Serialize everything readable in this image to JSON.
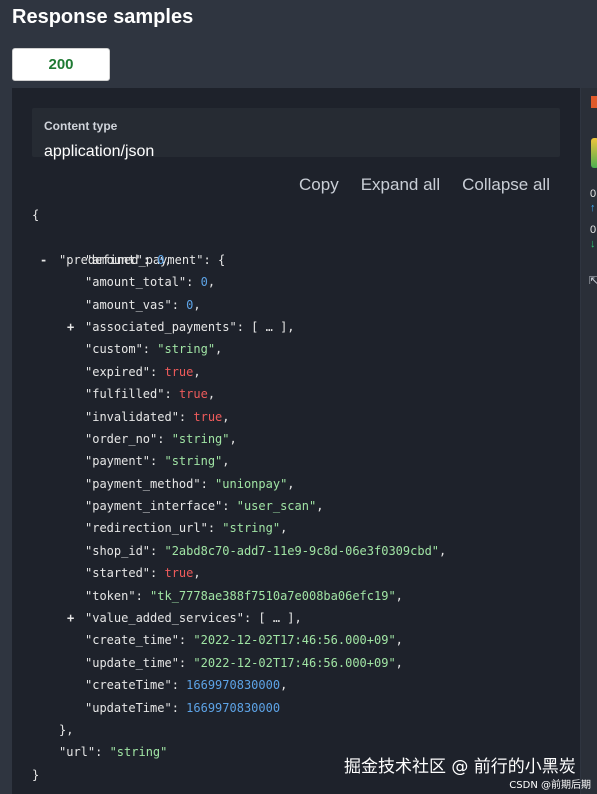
{
  "header": {
    "title": "Response samples"
  },
  "tabs": [
    {
      "label": "200"
    }
  ],
  "content_type": {
    "label": "Content type",
    "value": "application/json"
  },
  "actions": {
    "copy": "Copy",
    "expand_all": "Expand all",
    "collapse_all": "Collapse all"
  },
  "code": {
    "open_brace": "{",
    "close_brace": "}",
    "predefined_key": "\"predefined_payment\"",
    "predefined_open": ": {",
    "predefined_close": "},",
    "collapse_sign": "-",
    "expand_sign": "+",
    "fields": [
      {
        "key": "\"amount\"",
        "value": "0",
        "type": "n",
        "suffix": ","
      },
      {
        "key": "\"amount_total\"",
        "value": "0",
        "type": "n",
        "suffix": ","
      },
      {
        "key": "\"amount_vas\"",
        "value": "0",
        "type": "n",
        "suffix": ","
      },
      {
        "key": "\"associated_payments\"",
        "value": "[ … ]",
        "type": "p",
        "suffix": ",",
        "toggle": "+"
      },
      {
        "key": "\"custom\"",
        "value": "\"string\"",
        "type": "s",
        "suffix": ","
      },
      {
        "key": "\"expired\"",
        "value": "true",
        "type": "b",
        "suffix": ","
      },
      {
        "key": "\"fulfilled\"",
        "value": "true",
        "type": "b",
        "suffix": ","
      },
      {
        "key": "\"invalidated\"",
        "value": "true",
        "type": "b",
        "suffix": ","
      },
      {
        "key": "\"order_no\"",
        "value": "\"string\"",
        "type": "s",
        "suffix": ","
      },
      {
        "key": "\"payment\"",
        "value": "\"string\"",
        "type": "s",
        "suffix": ","
      },
      {
        "key": "\"payment_method\"",
        "value": "\"unionpay\"",
        "type": "s",
        "suffix": ","
      },
      {
        "key": "\"payment_interface\"",
        "value": "\"user_scan\"",
        "type": "s",
        "suffix": ","
      },
      {
        "key": "\"redirection_url\"",
        "value": "\"string\"",
        "type": "s",
        "suffix": ","
      },
      {
        "key": "\"shop_id\"",
        "value": "\"2abd8c70-add7-11e9-9c8d-06e3f0309cbd\"",
        "type": "s",
        "suffix": ","
      },
      {
        "key": "\"started\"",
        "value": "true",
        "type": "b",
        "suffix": ","
      },
      {
        "key": "\"token\"",
        "value": "\"tk_7778ae388f7510a7e008ba06efc19\"",
        "type": "s",
        "suffix": ","
      },
      {
        "key": "\"value_added_services\"",
        "value": "[ … ]",
        "type": "p",
        "suffix": ",",
        "toggle": "+"
      },
      {
        "key": "\"create_time\"",
        "value": "\"2022-12-02T17:46:56.000+09\"",
        "type": "s",
        "suffix": ","
      },
      {
        "key": "\"update_time\"",
        "value": "\"2022-12-02T17:46:56.000+09\"",
        "type": "s",
        "suffix": ","
      },
      {
        "key": "\"createTime\"",
        "value": "1669970830000",
        "type": "n",
        "suffix": ","
      },
      {
        "key": "\"updateTime\"",
        "value": "1669970830000",
        "type": "n",
        "suffix": ""
      }
    ],
    "url_key": "\"url\"",
    "url_value": "\"string\""
  },
  "watermark": "掘金技术社区 @ 前行的小黑炭",
  "csdn_mark": "CSDN @前期后期",
  "right_sidebar": {
    "counts": [
      "0",
      "0"
    ]
  }
}
